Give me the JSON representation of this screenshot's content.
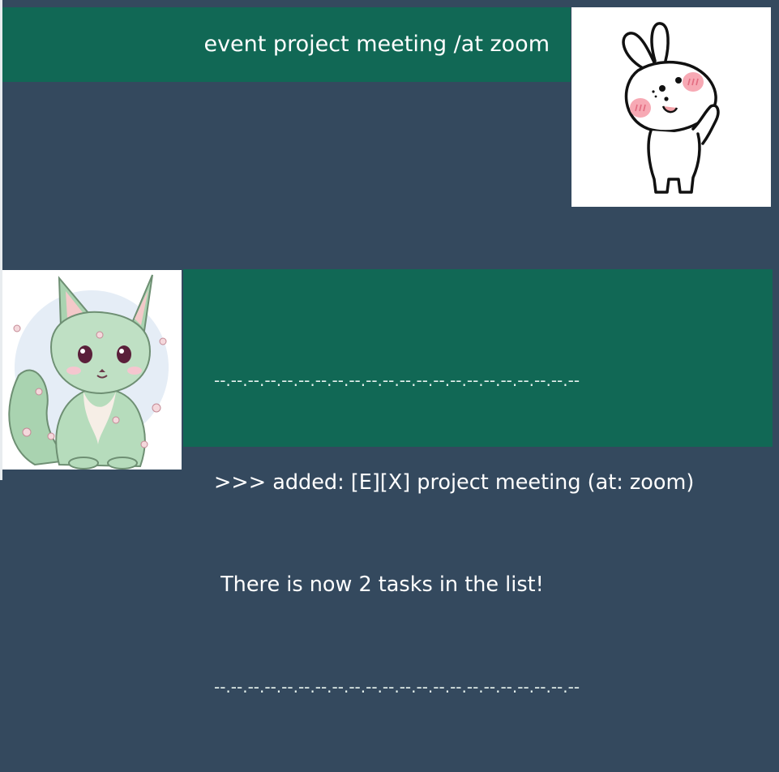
{
  "user_message": {
    "text": "event project meeting /at zoom",
    "avatar_icon": "bunny-avatar-icon"
  },
  "bot_message": {
    "divider_top": "--.--.--.--.--.--.--.--.--.--.--.--.--.--.--.--.--.--.--.--.--.--",
    "line1": ">>> added: [E][X] project meeting (at: zoom)",
    "line2": " There is now 2 tasks in the list!",
    "divider_bottom": "--.--.--.--.--.--.--.--.--.--.--.--.--.--.--.--.--.--.--.--.--.--",
    "avatar_icon": "fox-avatar-icon"
  },
  "colors": {
    "background": "#34495e",
    "bubble": "#116855",
    "text": "#ffffff"
  }
}
